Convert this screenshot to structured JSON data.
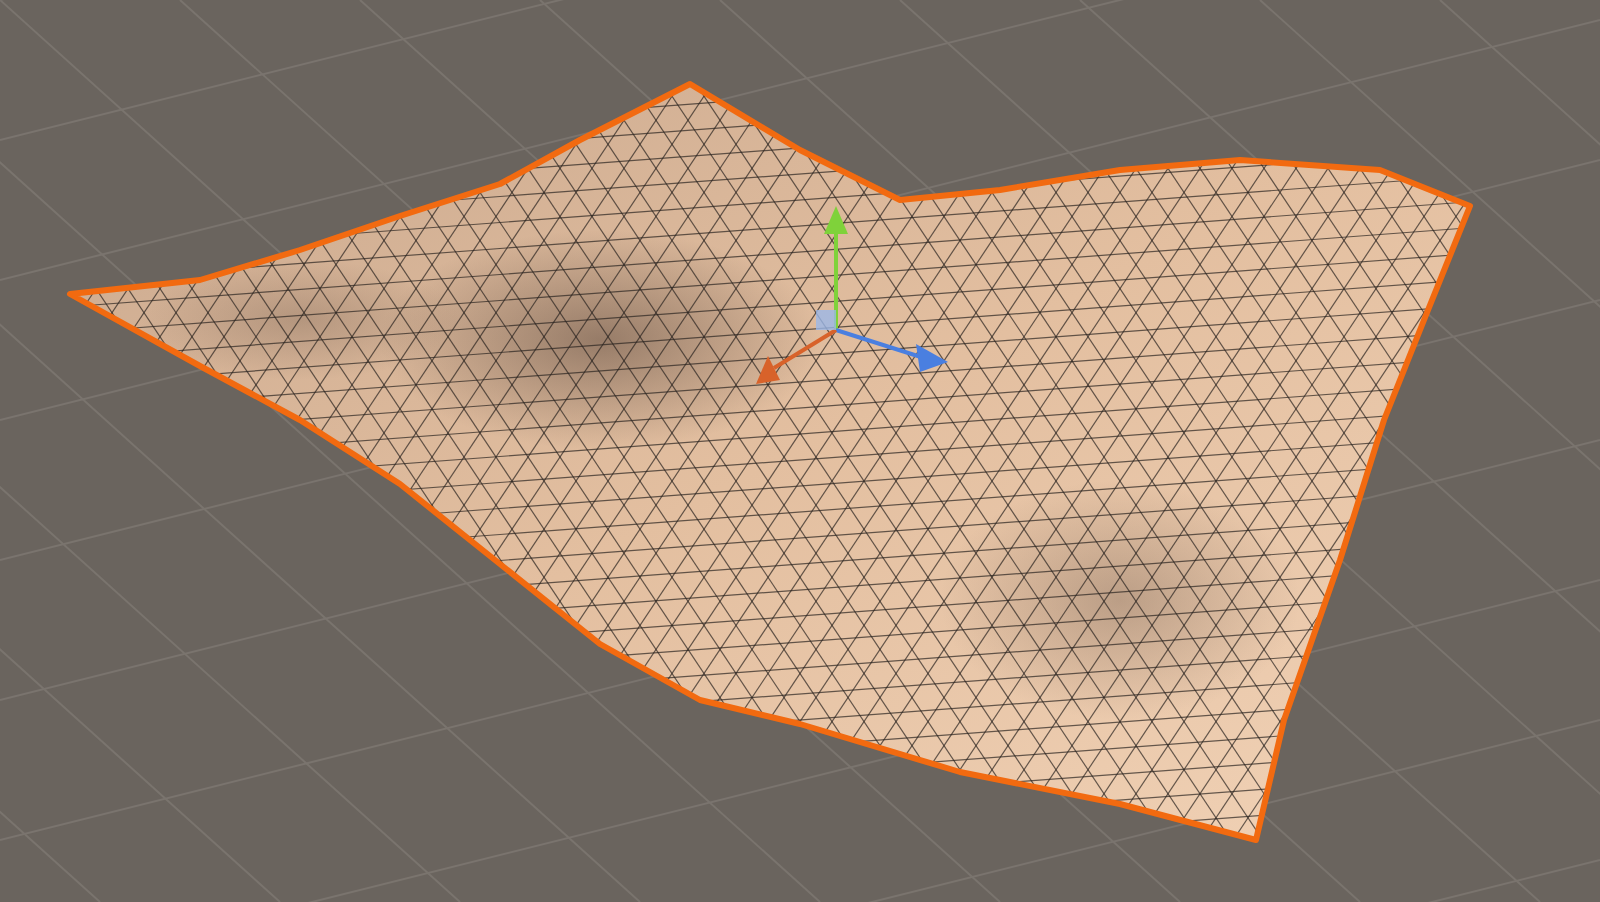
{
  "viewport": {
    "mesh": {
      "selected": true
    },
    "gizmo": {
      "visible": true
    }
  }
}
